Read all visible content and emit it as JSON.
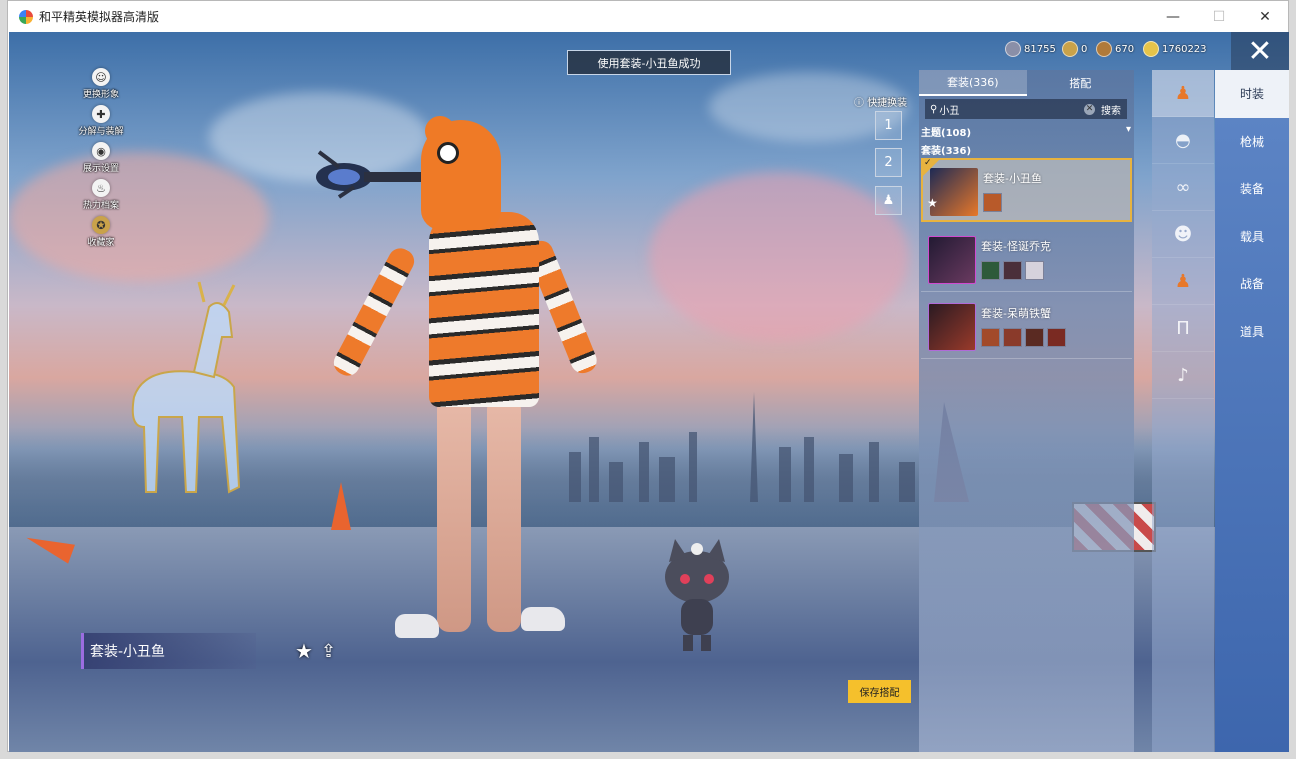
{
  "window": {
    "title": "和平精英模拟器高清版",
    "controls": {
      "minimize": "—",
      "maximize": "☐",
      "close": "✕"
    }
  },
  "toast": "使用套装-小丑鱼成功",
  "left_menu": [
    {
      "label": "更换形象",
      "icon": "person-icon"
    },
    {
      "label": "分解与装解",
      "icon": "puzzle-icon"
    },
    {
      "label": "展示设置",
      "icon": "eye-icon"
    },
    {
      "label": "热力档案",
      "icon": "flame-icon"
    },
    {
      "label": "收藏家",
      "icon": "medal-icon"
    }
  ],
  "currencies": [
    {
      "value": "81755",
      "color": "#8a8fa8"
    },
    {
      "value": "0",
      "color": "#c9a24a"
    },
    {
      "value": "670",
      "color": "#b07a3a"
    },
    {
      "value": "1760223",
      "color": "#e6c44a"
    }
  ],
  "quick_change": {
    "label": "快捷换装",
    "slots": [
      "1",
      "2",
      "♟"
    ]
  },
  "panel": {
    "tabs": [
      "套装(336)",
      "搭配"
    ],
    "search": {
      "value": "小丑",
      "button": "搜索"
    },
    "filter": "主题(108)",
    "section_title": "套装(336)",
    "outfits": [
      {
        "name": "套装-小丑鱼",
        "selected": true,
        "part_count": 1,
        "thumb_color": "#e8782a"
      },
      {
        "name": "套装-怪诞乔克",
        "selected": false,
        "part_count": 3,
        "thumb_color": "#5a2f55"
      },
      {
        "name": "套装-呆萌铁蟹",
        "selected": false,
        "part_count": 4,
        "thumb_color": "#8a3a2a"
      }
    ]
  },
  "categories": [
    {
      "label": "时装",
      "icon": "outfit-icon",
      "active": true
    },
    {
      "label": "枪械",
      "icon": "helmet-icon",
      "active": false
    },
    {
      "label": "装备",
      "icon": "goggles-icon",
      "active": false
    },
    {
      "label": "载具",
      "icon": "mask-icon",
      "active": false
    },
    {
      "label": "战备",
      "icon": "top-icon",
      "active": false
    },
    {
      "label": "道具",
      "icon": "pants-icon",
      "active": false
    },
    {
      "label": "",
      "icon": "shoes-icon",
      "active": false
    }
  ],
  "current_outfit": "套装-小丑鱼",
  "save_button": "保存搭配"
}
